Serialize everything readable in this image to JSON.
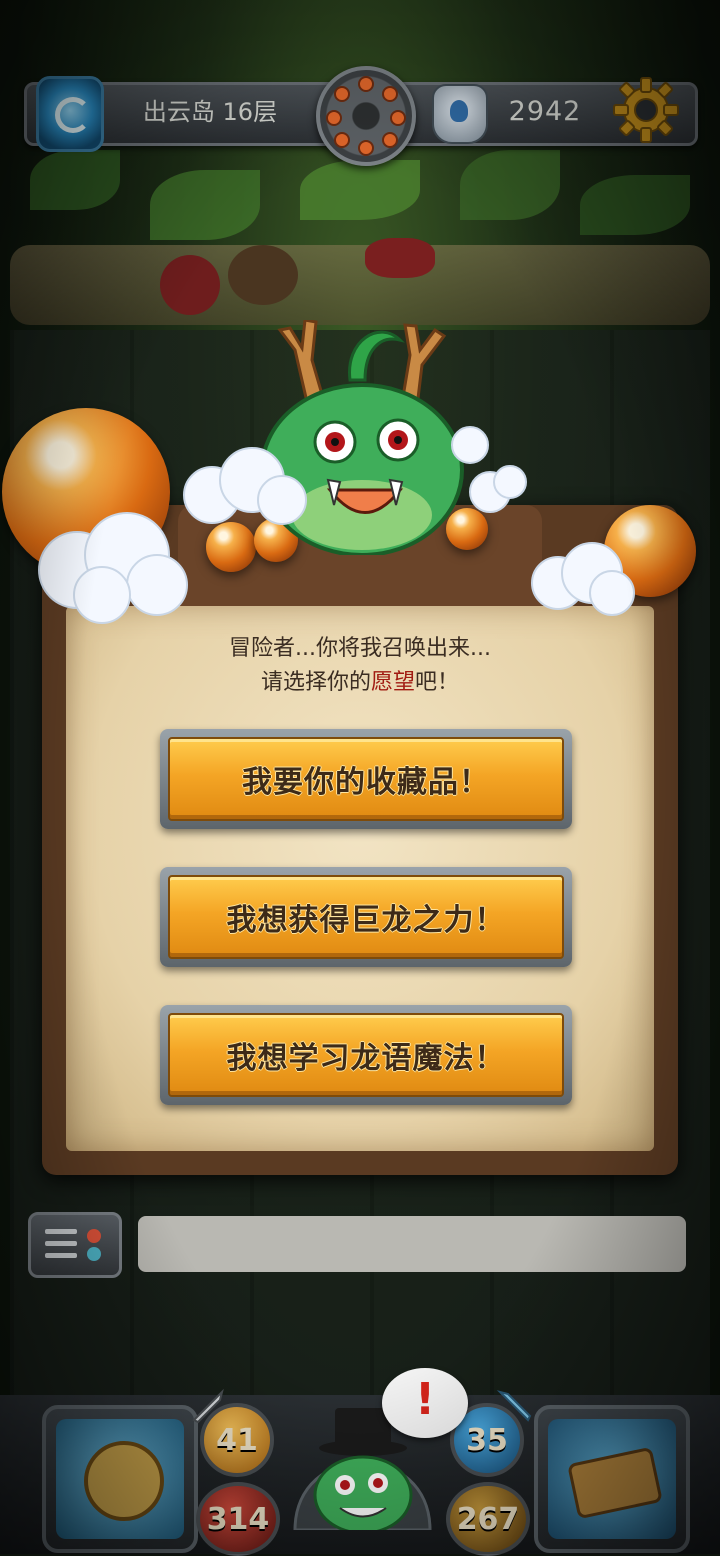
{
  "header": {
    "floor_label": "出云岛 16层",
    "coin_count": "2942"
  },
  "dialog": {
    "line1": "冒险者...你将我召唤出来...",
    "line2_prefix": "请选择你的",
    "line2_highlight": "愿望",
    "line2_suffix": "吧！"
  },
  "options": [
    {
      "label": "我要你的收藏品！"
    },
    {
      "label": "我想获得巨龙之力！"
    },
    {
      "label": "我想学习龙语魔法！"
    }
  ],
  "chat": {
    "input_value": ""
  },
  "stats": {
    "attack": "41",
    "defense": "35",
    "hp": "314",
    "gold": "267"
  },
  "alert": {
    "symbol": "!"
  },
  "colors": {
    "button_gold": "#f4a525",
    "highlight_red": "#a11b12",
    "parchment": "#e6d2a8"
  },
  "icons": {
    "portal": "portal-icon",
    "compass": "compass-icon",
    "key": "key-icon",
    "settings": "gear-icon",
    "menu": "menu-icon",
    "shield_attack": "sword-icon",
    "shield_defense": "shield-icon"
  }
}
